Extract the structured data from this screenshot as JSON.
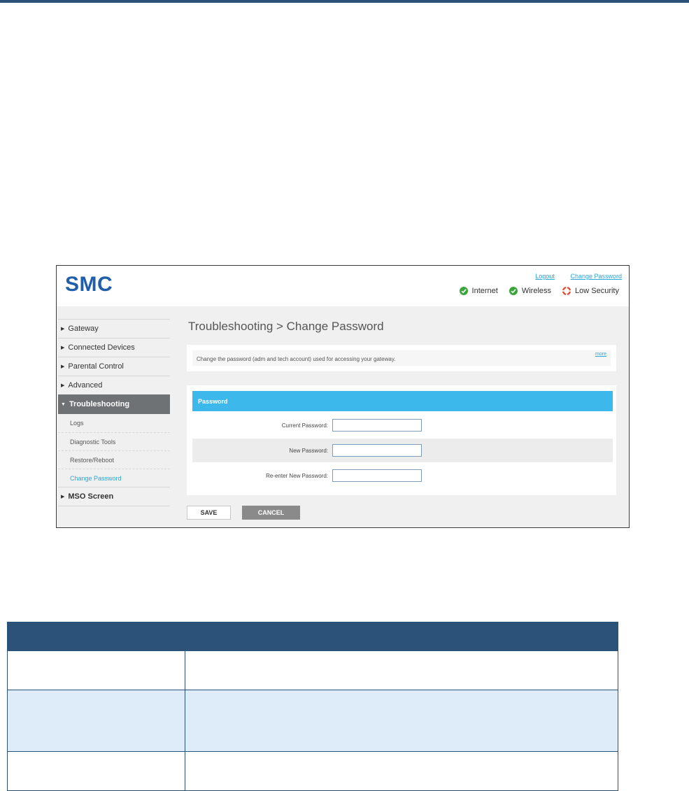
{
  "router_ui": {
    "logo": "SMC",
    "top_links": {
      "logout": "Logout",
      "change_password": "Change Password"
    },
    "status": [
      {
        "label": "Internet",
        "state": "ok",
        "icon": "check-icon",
        "color": "#3aa53a"
      },
      {
        "label": "Wireless",
        "state": "ok",
        "icon": "check-icon",
        "color": "#3aa53a"
      },
      {
        "label": "Low Security",
        "state": "warning",
        "icon": "lifebuoy-icon",
        "color": "#e8462b"
      }
    ],
    "nav": {
      "gateway": "Gateway",
      "connected_devices": "Connected Devices",
      "parental_control": "Parental Control",
      "advanced": "Advanced",
      "troubleshooting": "Troubleshooting",
      "sub": {
        "logs": "Logs",
        "diagnostic_tools": "Diagnostic Tools",
        "restore_reboot": "Restore/Reboot",
        "change_password": "Change Password"
      },
      "mso_screen": "MSO Screen"
    },
    "page_title": "Troubleshooting > Change Password",
    "info": {
      "text": "Change the password (adm and tech account) used for accessing your gateway.",
      "more": "more"
    },
    "password_section": {
      "header": "Password",
      "current_label": "Current Password:",
      "new_label": "New Password:",
      "reenter_label": "Re-enter New Password:",
      "current_value": "",
      "new_value": "",
      "reenter_value": ""
    },
    "buttons": {
      "save": "SAVE",
      "cancel": "CANCEL"
    }
  },
  "doc_table": {
    "header": [
      "",
      ""
    ],
    "rows": [
      [
        "",
        ""
      ],
      [
        "",
        ""
      ],
      [
        "",
        ""
      ]
    ]
  },
  "colors": {
    "accent": "#3db8ea",
    "brand": "#1f5ea8",
    "table_header": "#2b5279",
    "row_highlight": "#ddecf8"
  }
}
